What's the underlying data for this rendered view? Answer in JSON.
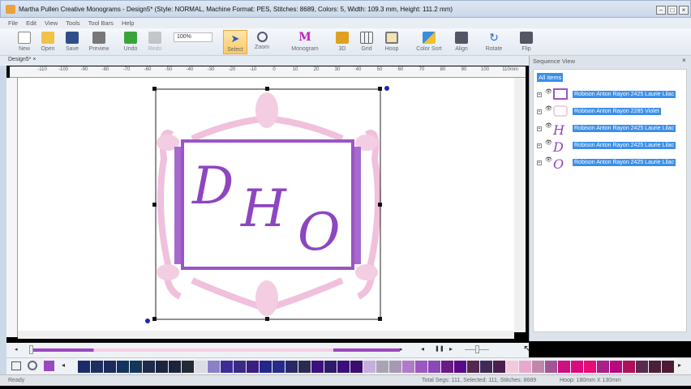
{
  "window": {
    "title": "Martha Pullen Creative Monograms - Design5* (Style: NORMAL, Machine Format: PES, Stitches: 8689, Colors: 5, Width: 109.3 mm, Height: 111.2 mm)"
  },
  "menu": [
    "File",
    "Edit",
    "View",
    "Tools",
    "Tool Bars",
    "Help"
  ],
  "toolbar": {
    "new": "New",
    "open": "Open",
    "save": "Save",
    "preview": "Preview",
    "undo": "Undo",
    "redo": "Redo",
    "zoom_value": "100%",
    "select": "Select",
    "zoom": "Zoom",
    "monogram": "Monogram",
    "three_d": "3D",
    "grid": "Grid",
    "hoop": "Hoop",
    "color_sort": "Color Sort",
    "align": "Align",
    "rotate": "Rotate",
    "flip": "Flip"
  },
  "tab": {
    "label": "Design5*"
  },
  "ruler": {
    "ticks": [
      "-110",
      "-100",
      "-90",
      "-80",
      "-70",
      "-60",
      "-50",
      "-40",
      "-30",
      "-20",
      "-10",
      "0",
      "10",
      "20",
      "30",
      "40",
      "50",
      "60",
      "70",
      "80",
      "90",
      "100",
      "110"
    ],
    "unit": "mm"
  },
  "design": {
    "letters": [
      "D",
      "H",
      "O"
    ],
    "accent": "#8a3fbf",
    "frame_color": "#f0c0dc"
  },
  "sequence": {
    "title": "Sequence View",
    "all_items": "All items",
    "items": [
      {
        "label": "Robison Anton Rayon 2425 Laurie Lilac",
        "icon": "frame-rect"
      },
      {
        "label": "Robison Anton Rayon 2285 Violet",
        "icon": "frame-ornament"
      },
      {
        "label": "Robison Anton Rayon 2425 Laurie Lilac",
        "icon": "H"
      },
      {
        "label": "Robison Anton Rayon 2425 Laurie Lilac",
        "icon": "D"
      },
      {
        "label": "Robison Anton Rayon 2425 Laurie Lilac",
        "icon": "O"
      }
    ]
  },
  "palette": [
    "#1d2a6a",
    "#1b2f60",
    "#1c2a5e",
    "#12345e",
    "#143659",
    "#1e2a49",
    "#1c2440",
    "#1c233c",
    "#222a35",
    "#dcdce4",
    "#8a80c8",
    "#3d2c98",
    "#3a2a84",
    "#3a1e80",
    "#24268a",
    "#262a8a",
    "#282866",
    "#2b2a52",
    "#3a117e",
    "#2d1a6a",
    "#3c0e7c",
    "#3a0d6e",
    "#c8aedc",
    "#a8a4b2",
    "#a898b4",
    "#b07ac8",
    "#9a58c0",
    "#8a48b8",
    "#6a1a80",
    "#5a0a88",
    "#52284e",
    "#402a5a",
    "#4a1e4e",
    "#f4c8dc",
    "#e8a8cc",
    "#c088a8",
    "#a45494",
    "#cc1080",
    "#d80c80",
    "#e80c74",
    "#a82088",
    "#b80880",
    "#b0105a",
    "#5a2a52",
    "#4a2038",
    "#4c1a34",
    "#f0f0f0"
  ],
  "current_color": "#9a48c0",
  "status": {
    "ready": "Ready",
    "segs": "Total Segs: 111, Selected: 111, Stitches: 8689",
    "hoop": "Hoop: 180mm X 130mm"
  }
}
